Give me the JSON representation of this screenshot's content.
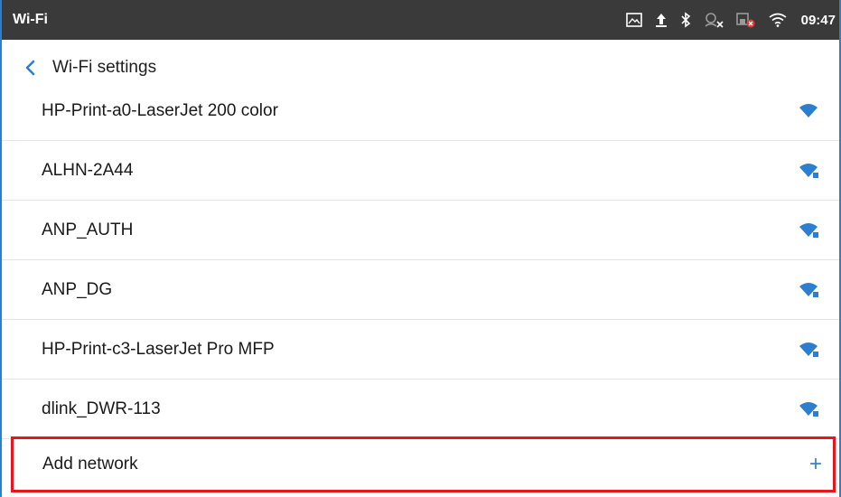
{
  "statusbar": {
    "title": "Wi-Fi",
    "time": "09:47",
    "icons": [
      "gallery-icon",
      "upload-icon",
      "bluetooth-icon",
      "account-off-icon",
      "ethernet-error-icon",
      "wifi-icon"
    ]
  },
  "header": {
    "title": "Wi-Fi settings",
    "back_icon": "chevron-left-icon"
  },
  "networks": [
    {
      "name": "HP-Print-a0-LaserJet 200 color",
      "secured": false
    },
    {
      "name": "ALHN-2A44",
      "secured": true
    },
    {
      "name": "ANP_AUTH",
      "secured": true
    },
    {
      "name": "ANP_DG",
      "secured": true
    },
    {
      "name": "HP-Print-c3-LaserJet Pro MFP",
      "secured": true
    },
    {
      "name": "dlink_DWR-113",
      "secured": true
    }
  ],
  "add_network": {
    "label": "Add network",
    "icon": "+"
  },
  "colors": {
    "statusbar_bg": "#3a3a3a",
    "accent": "#2c7fd0",
    "highlight_border": "#e4171f"
  }
}
